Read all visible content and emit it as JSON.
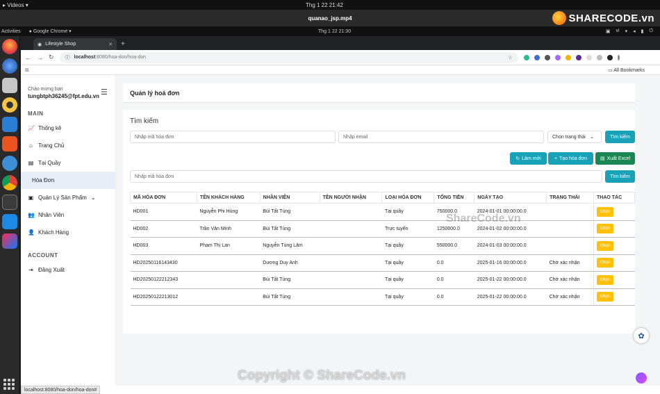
{
  "os": {
    "app_menu": "Videos",
    "clock": "Thg 1 22  21:42",
    "video_title": "quanao_jsp.mp4",
    "logo_text": "SHARECODE.vn"
  },
  "ubuntu": {
    "activities": "Activities",
    "app": "Google Chrome",
    "clock": "Thg 1 22  21:30",
    "lang": "vi"
  },
  "browser": {
    "tab_title": "Lifestyle Shop",
    "url_host": "localhost",
    "url_path": ":8080/hoa-don/hoa-don",
    "all_bookmarks": "All Bookmarks",
    "status_url": "localhost:8080/hoa-don/hoa-don#"
  },
  "sidebar": {
    "greeting": "Chào mừng bạn",
    "user_email": "tungbtph36245@fpt.edu.vn",
    "main_section": "MAIN",
    "items": [
      {
        "label": "Thống kê",
        "icon": "chart-line-icon"
      },
      {
        "label": "Trang Chủ",
        "icon": "home-icon"
      },
      {
        "label": "Tại Quầy",
        "icon": "cash-register-icon"
      },
      {
        "label": "Hóa Đơn",
        "icon": "invoice-icon"
      },
      {
        "label": "Quản Lý Sản Phẩm",
        "icon": "box-icon"
      },
      {
        "label": "Nhân Viên",
        "icon": "users-icon"
      },
      {
        "label": "Khách Hàng",
        "icon": "user-icon"
      }
    ],
    "account_section": "ACCOUNT",
    "logout": "Đăng Xuất"
  },
  "header": {
    "title": "Quản lý hoá đơn"
  },
  "search": {
    "title": "Tìm kiếm",
    "invoice_placeholder": "Nhập mã hóa đơn",
    "email_placeholder": "Nhập email",
    "status_select": "Chọn trạng thái",
    "search_button": "Tìm kiếm",
    "refresh_button": "Làm mới",
    "create_button": "Tạo hóa đơn",
    "export_button": "Xuất Excel",
    "invoice_placeholder2": "Nhập mã hóa đơn",
    "search_button2": "Tìm kiếm"
  },
  "table": {
    "headers": [
      "MÃ HÓA ĐƠN",
      "TÊN KHÁCH HÀNG",
      "NHÂN VIÊN",
      "TÊN NGƯỜI NHẬN",
      "LOẠI HÓA ĐƠN",
      "TỔNG TIỀN",
      "NGÀY TẠO",
      "TRẠNG THÁI",
      "THAO TÁC"
    ],
    "rows": [
      [
        "HD001",
        "Nguyễn Phi Hùng",
        "Bùi Tất Tùng",
        "",
        "Tại quầy",
        "750000.0",
        "2024-01-01 00:00:00.0",
        "",
        "Chọn"
      ],
      [
        "HD002",
        "Trần Văn Minh",
        "Bùi Tất Tùng",
        "",
        "Trực tuyến",
        "1250000.0",
        "2024-01-02 00:00:00.0",
        "",
        "Chọn"
      ],
      [
        "HD003",
        "Phạm Thị Lan",
        "Nguyễn Tùng Lâm",
        "",
        "Tại quầy",
        "550000.0",
        "2024-01-03 00:00:00.0",
        "",
        "Chọn"
      ],
      [
        "HD20250116143430",
        "",
        "Dương Duy Anh",
        "",
        "Tại quầy",
        "0.0",
        "2025-01-16 00:00:00.0",
        "Chờ xác nhận",
        "Chọn"
      ],
      [
        "HD20250122212343",
        "",
        "Bùi Tất Tùng",
        "",
        "Tại quầy",
        "0.0",
        "2025-01-22 00:00:00.0",
        "Chờ xác nhận",
        "Chọn"
      ],
      [
        "HD20250122213012",
        "",
        "Bùi Tất Tùng",
        "",
        "Tại quầy",
        "0.0",
        "2025-01-22 00:00:00.0",
        "Chờ xác nhận",
        "Chọn"
      ]
    ]
  },
  "watermarks": {
    "center": "ShareCode.vn",
    "copyright": "Copyright © ShareCode.vn"
  },
  "colors": {
    "teal": "#17a2b8",
    "green": "#198754",
    "yellow": "#ffc107",
    "active_nav": "#e8eef6"
  }
}
